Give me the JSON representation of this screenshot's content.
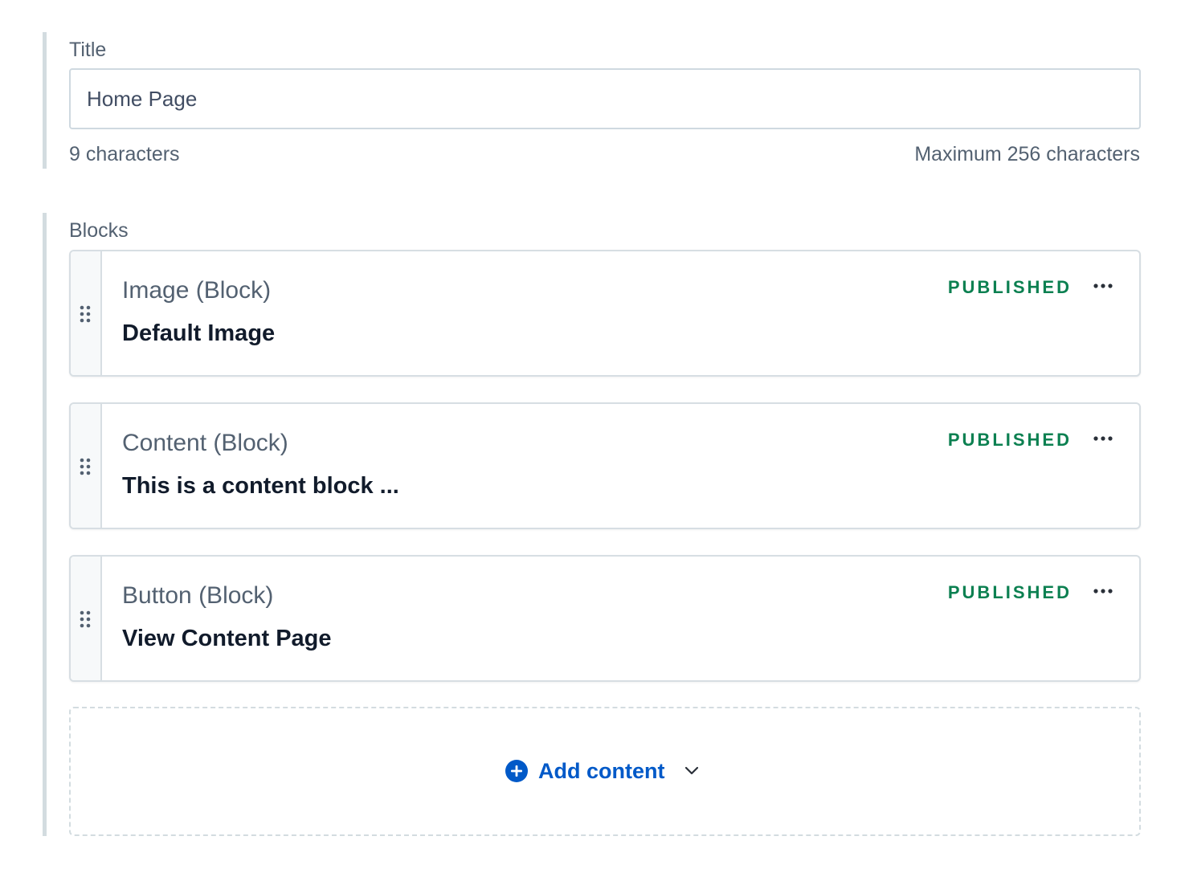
{
  "title_field": {
    "label": "Title",
    "value": "Home Page",
    "char_count": "9 characters",
    "char_max": "Maximum 256 characters"
  },
  "blocks_field": {
    "label": "Blocks",
    "items": [
      {
        "type": "Image (Block)",
        "name": "Default Image",
        "status": "PUBLISHED"
      },
      {
        "type": "Content (Block)",
        "name": "This is a content block ...",
        "status": "PUBLISHED"
      },
      {
        "type": "Button (Block)",
        "name": "View Content Page",
        "status": "PUBLISHED"
      }
    ],
    "add_label": "Add content"
  },
  "colors": {
    "published": "#0c8051",
    "accent": "#0059c8",
    "field_border": "#d3dce0"
  },
  "icons": {
    "drag_handle": "drag-handle-icon",
    "more": "more-horizontal-icon",
    "add": "plus-circle-icon",
    "dropdown": "chevron-down-icon"
  }
}
